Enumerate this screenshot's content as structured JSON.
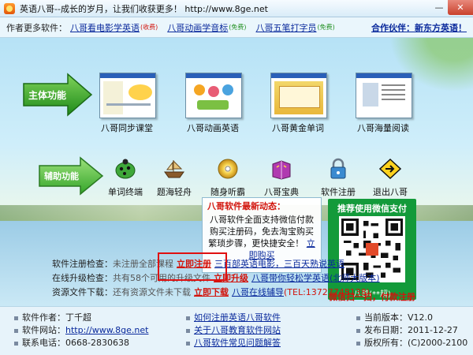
{
  "window": {
    "title": "英语八哥--成长的岁月，让我们收获更多！ http://www.8ge.net",
    "min": "—",
    "close": "✕"
  },
  "author_bar": {
    "label": "作者更多软件：",
    "items": [
      {
        "text": "八哥看电影学英语",
        "tag": "(收费)",
        "tag_color": "red"
      },
      {
        "text": "八哥动画学音标",
        "tag": "(免费)",
        "tag_color": "green"
      },
      {
        "text": "八哥五笔打字员",
        "tag": "(免费)",
        "tag_color": "green"
      }
    ],
    "partner": "合作伙伴：新东方英语！"
  },
  "main_functions": {
    "arrow_label": "主体功能",
    "items": [
      "八哥同步课堂",
      "八哥动画英语",
      "八哥黄金单词",
      "八哥海量阅读"
    ]
  },
  "aux_functions": {
    "arrow_label": "辅助功能",
    "items": [
      {
        "label": "单词终端",
        "icon": "ladybug-icon"
      },
      {
        "label": "题海轻舟",
        "icon": "boat-icon"
      },
      {
        "label": "随身听霸",
        "icon": "cd-icon"
      },
      {
        "label": "八哥宝典",
        "icon": "book-icon"
      },
      {
        "label": "软件注册",
        "icon": "lock-icon"
      },
      {
        "label": "退出八哥",
        "icon": "exit-icon"
      }
    ]
  },
  "news": {
    "heading": "八哥软件最新动态：",
    "body": "八哥软件全面支持微信付款购买注册码，免去淘宝购买繁琐步骤，更快捷安全！",
    "buy_link": "立即购买"
  },
  "wechat": {
    "heading": "推荐使用微信支付",
    "name": "八哥(**超)",
    "scan_text": "微信扫一扫，付款注册"
  },
  "checks": {
    "register": {
      "key": "软件注册检查：",
      "value": "未注册全部课程",
      "action": "立即注册",
      "link": "三百部英语电影，三百天熟说英语"
    },
    "upgrade": {
      "key": "在线升级检查：",
      "value": "共有58个可用的升级文件",
      "action": "立即升级",
      "link": "八哥带你轻松学英语(北师大版本)"
    },
    "resources": {
      "key": "资源文件下载：",
      "value": "还有资源文件未下载",
      "action": "立即下载",
      "link": "八哥在线辅导",
      "extra": "(TEL:13727748138)"
    }
  },
  "footer": {
    "author_label": "软件作者：",
    "author": "丁千超",
    "site_label": "软件网站：",
    "site": "http://www.8ge.net",
    "phone_label": "联系电话：",
    "phone": "0668-2830638",
    "links": [
      "如何注册英语八哥软件",
      "关于八哥教育软件网站",
      "八哥软件常见问题解答"
    ],
    "version_label": "当前版本：",
    "version": "V12.0",
    "date_label": "发布日期：",
    "date": "2011-12-27",
    "copyright_label": "版权所有：",
    "copyright": "(C)2000-2100"
  },
  "colors": {
    "accent_red": "#d2140c",
    "link_blue": "#0a2a9c",
    "wechat_green": "#139a3a",
    "arrow_green": "#2fa82a"
  }
}
